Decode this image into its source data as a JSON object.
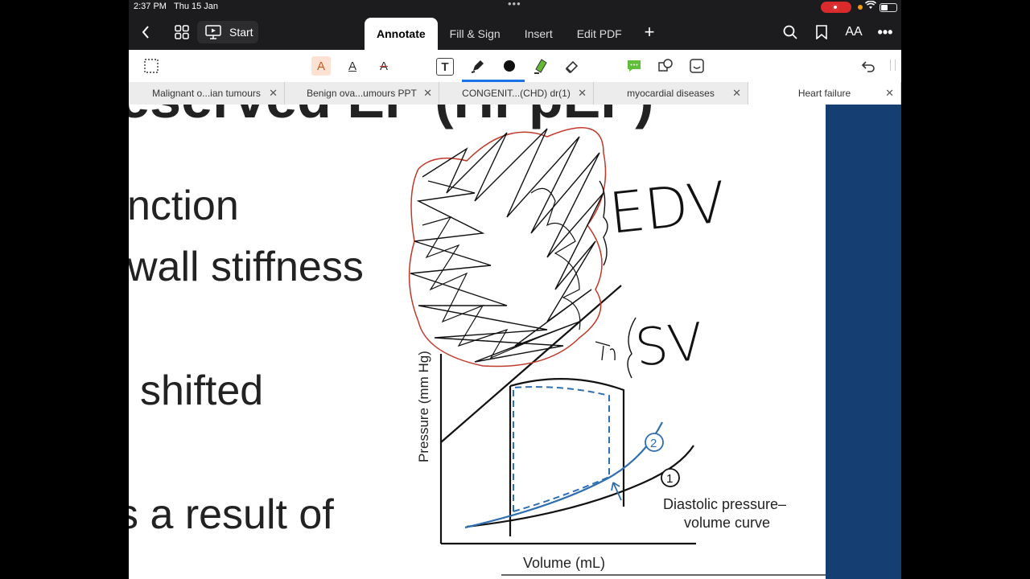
{
  "status": {
    "time": "2:37 PM",
    "date": "Thu 15 Jan",
    "dots": "•••"
  },
  "nav": {
    "start_label": "Start",
    "tabs": [
      {
        "label": "Annotate",
        "active": true
      },
      {
        "label": "Fill & Sign"
      },
      {
        "label": "Insert"
      },
      {
        "label": "Edit PDF"
      }
    ],
    "textsize_label": "AA"
  },
  "toolbar": {
    "text_highlight": "A",
    "text_underline": "A",
    "text_strike": "A",
    "textbox": "T"
  },
  "doc_tabs": [
    {
      "label": "Malignant o...ian tumours"
    },
    {
      "label": "Benign ova...umours PPT"
    },
    {
      "label": "CONGENIT...(CHD) dr(1)"
    },
    {
      "label": "myocardial diseases"
    },
    {
      "label": "Heart failure",
      "active": true
    }
  ],
  "slide": {
    "title_partial": "reserved EF (HFpEF)",
    "lines": [
      "nction",
      "wall stiffness",
      "shifted",
      "s a result of"
    ]
  },
  "diagram": {
    "ylabel": "Pressure (mm Hg)",
    "xlabel": "Volume (mL)",
    "curve_label_line1": "Diastolic pressure–",
    "curve_label_line2": "volume curve",
    "marker_1": "1",
    "marker_2": "2"
  },
  "handwriting": {
    "edv": "EDV",
    "sv": "SV"
  },
  "colors": {
    "accent_blue": "#1a73e8",
    "slide_bar": "#153e72",
    "ink_red": "#c0392b",
    "curve_blue": "#2f6fb0"
  }
}
